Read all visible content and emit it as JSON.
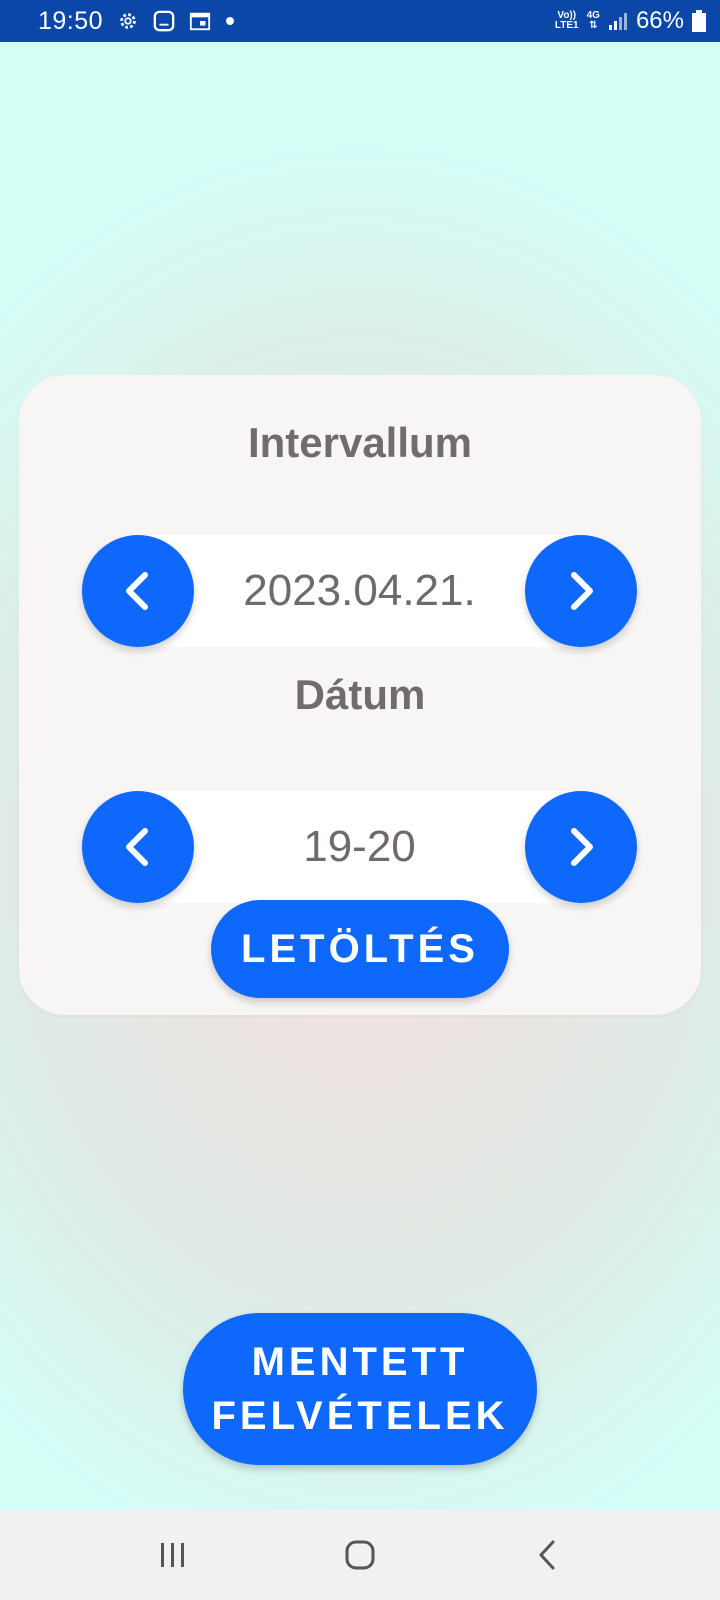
{
  "status_bar": {
    "time": "19:50",
    "net_top": "Vo))",
    "net_bottom": "LTE1",
    "net_type": "4G",
    "battery": "66%",
    "icons": [
      "gear-icon",
      "screen-icon",
      "calendar-icon",
      "dot-icon",
      "signal-icon",
      "battery-icon"
    ]
  },
  "card": {
    "interval_title": "Intervallum",
    "interval_value": "2023.04.21.",
    "date_title": "Dátum",
    "date_value": "19-20",
    "download_label": "LETÖLTÉS"
  },
  "saved_button": {
    "line1": "MENTETT",
    "line2": "FELVÉTELEK"
  },
  "nav_bar": {
    "icons": [
      "recent-apps-icon",
      "home-icon",
      "back-icon"
    ]
  },
  "colors": {
    "accent": "#0e68fb",
    "status_bar": "#0a47a9",
    "background": "#d4fdf6",
    "card": "#f8f6f5",
    "text_gray": "#706c6b"
  }
}
